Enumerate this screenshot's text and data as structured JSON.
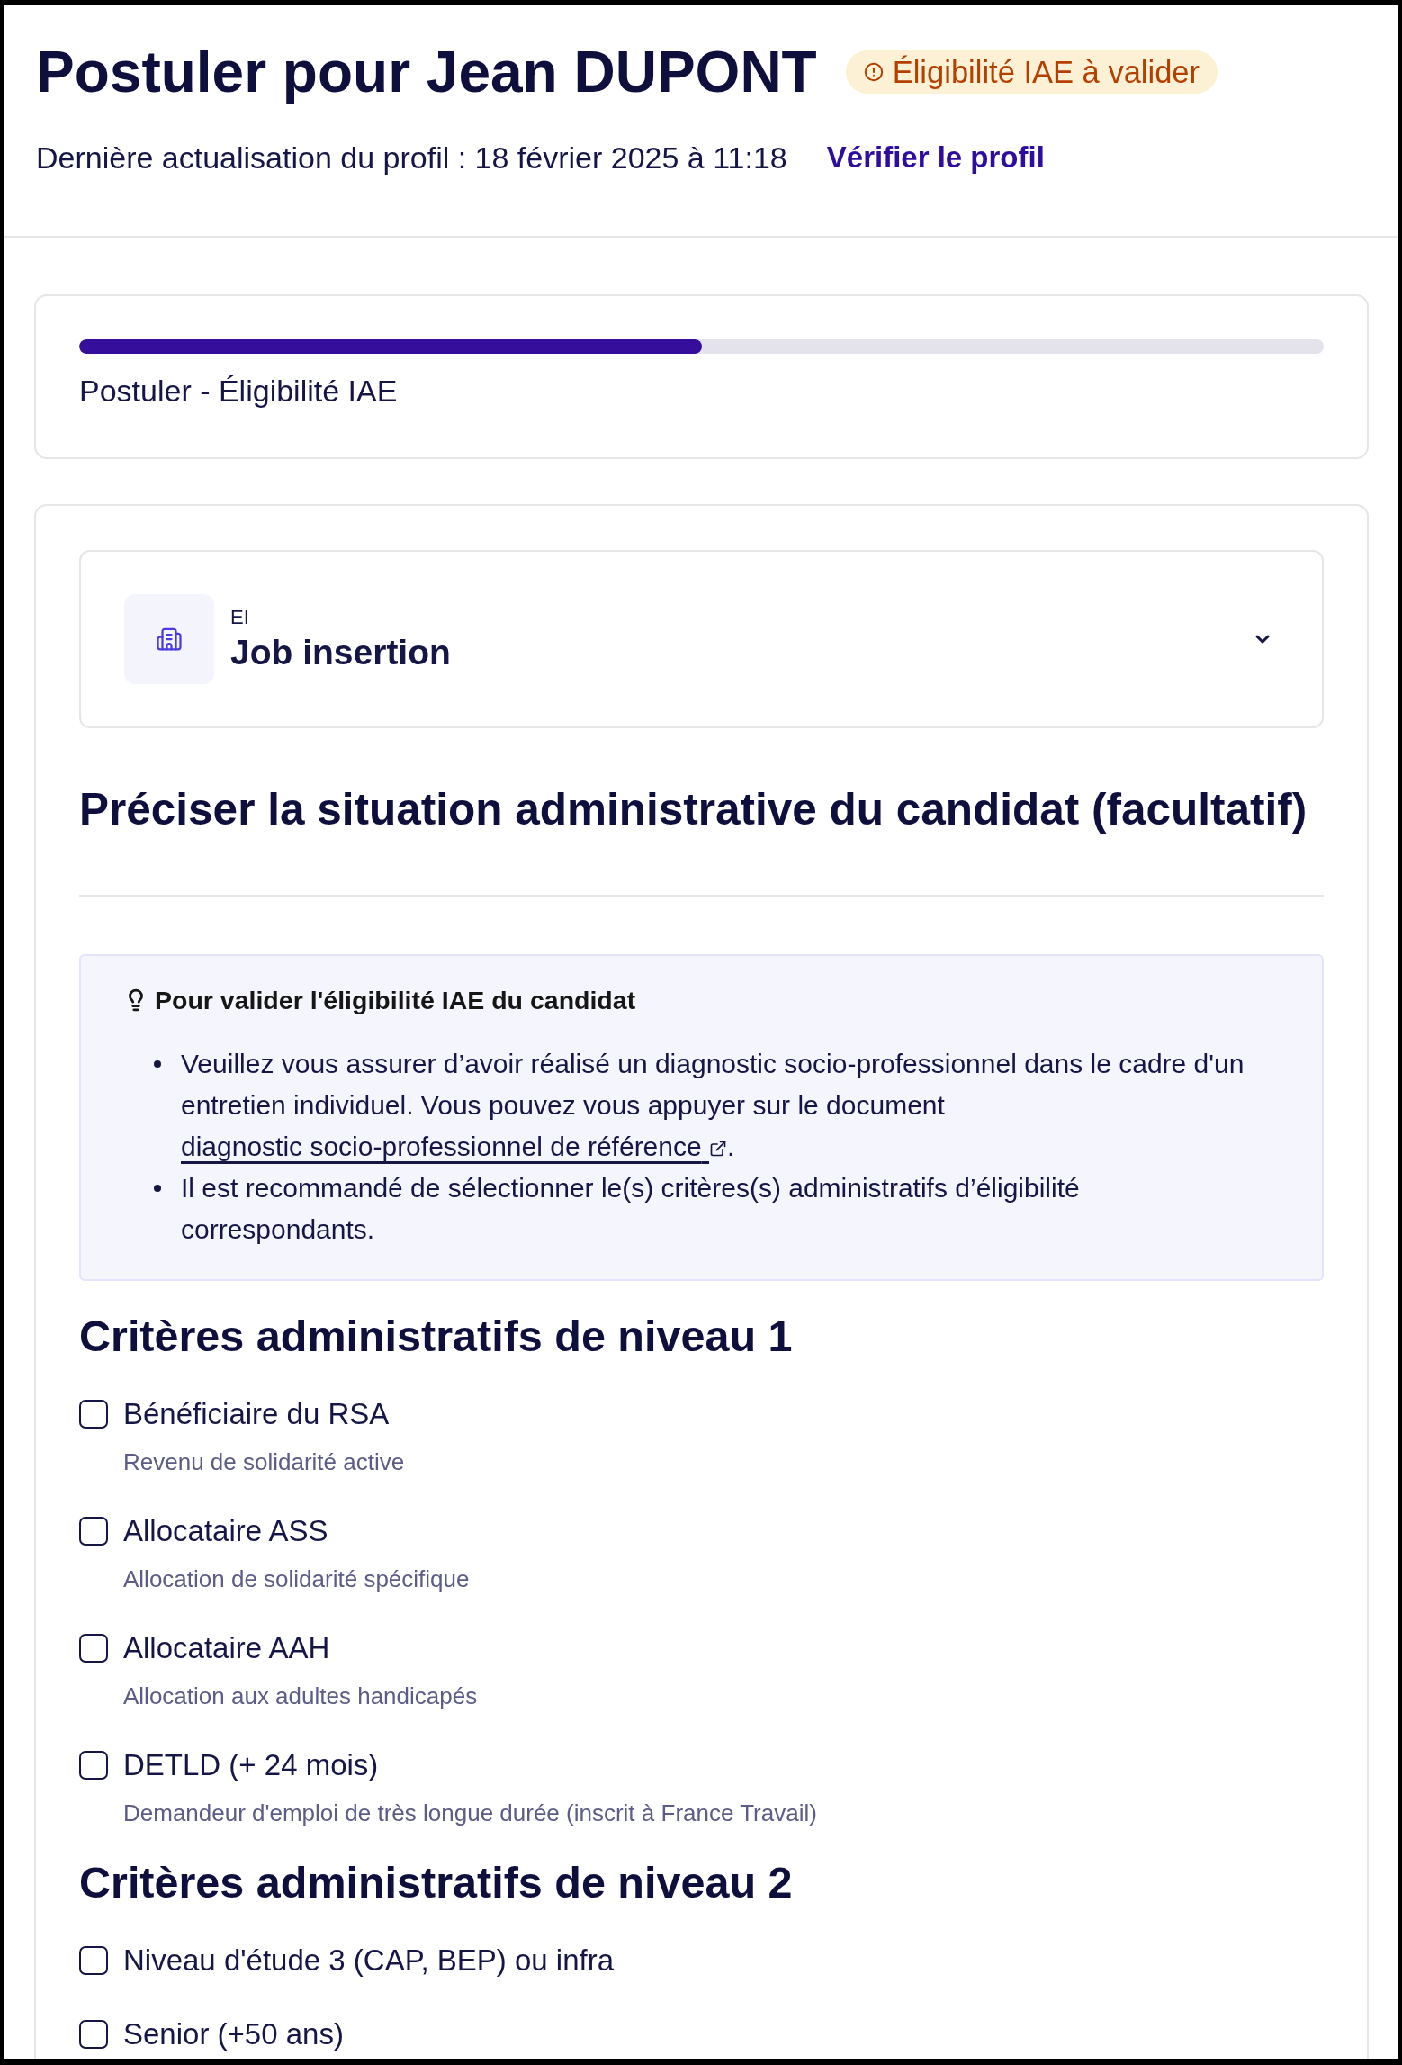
{
  "header": {
    "title": "Postuler pour Jean DUPONT",
    "badge": "Éligibilité IAE à valider",
    "last_update": "Dernière actualisation du profil : 18 février 2025 à 11:18",
    "link": "Vérifier le profil"
  },
  "progress": {
    "level": 0.5,
    "label": "Postuler - Éligibilité IAE"
  },
  "structure": {
    "type": "EI",
    "name": "Job insertion",
    "expanded": false
  },
  "section_title": "Préciser la situation administrative du candidat (facultatif)",
  "notice": {
    "title": "Pour valider l'éligibilité IAE du candidat",
    "items": [
      {
        "text": "Veuillez vous assurer d’avoir réalisé un diagnostic socio-professionnel dans le cadre d'un entretien individuel. Vous pouvez vous appuyer sur le document",
        "link": "diagnostic socio-professionnel de référence",
        "after": "."
      },
      {
        "text": "Il est recommandé de sélectionner le(s) critères(s) administratifs d’éligibilité correspondants."
      }
    ]
  },
  "criteria_levels": [
    {
      "title": "Critères administratifs de niveau 1",
      "criteria": [
        {
          "label": "Bénéficiaire du RSA",
          "hint": "Revenu de solidarité active",
          "checked": false
        },
        {
          "label": "Allocataire ASS",
          "hint": "Allocation de solidarité spécifique",
          "checked": false
        },
        {
          "label": "Allocataire AAH",
          "hint": "Allocation aux adultes handicapés",
          "checked": false
        },
        {
          "label": "DETLD (+ 24 mois)",
          "hint": "Demandeur d'emploi de très longue durée (inscrit à France Travail)",
          "checked": false
        }
      ]
    },
    {
      "title": "Critères administratifs de niveau 2",
      "criteria": [
        {
          "label": "Niveau d'étude 3 (CAP, BEP) ou infra",
          "checked": false
        },
        {
          "label": "Senior (+50 ans)",
          "checked": false
        }
      ]
    }
  ]
}
